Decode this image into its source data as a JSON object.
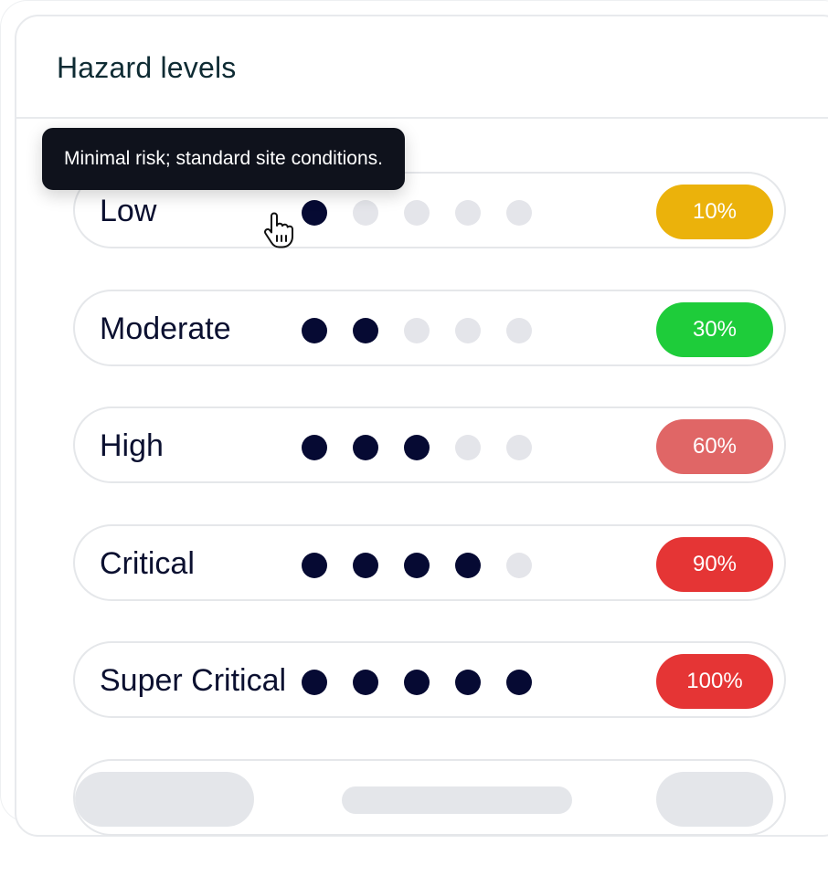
{
  "panel": {
    "title": "Hazard levels"
  },
  "tooltip": {
    "text": "Minimal risk; standard site conditions."
  },
  "levels": [
    {
      "label": "Low",
      "filled": 1,
      "total": 5,
      "percent": "10%",
      "color": "#ebb20b"
    },
    {
      "label": "Moderate",
      "filled": 2,
      "total": 5,
      "percent": "30%",
      "color": "#1ecc3a"
    },
    {
      "label": "High",
      "filled": 3,
      "total": 5,
      "percent": "60%",
      "color": "#e06666"
    },
    {
      "label": "Critical",
      "filled": 4,
      "total": 5,
      "percent": "90%",
      "color": "#e53535"
    },
    {
      "label": "Super Critical",
      "filled": 5,
      "total": 5,
      "percent": "100%",
      "color": "#e53535"
    }
  ],
  "colors": {
    "dot_on": "#060a33",
    "dot_off": "#e4e5ea",
    "skeleton": "#e4e6ea"
  },
  "cursor": {
    "icon": "hand-pointer-icon"
  }
}
